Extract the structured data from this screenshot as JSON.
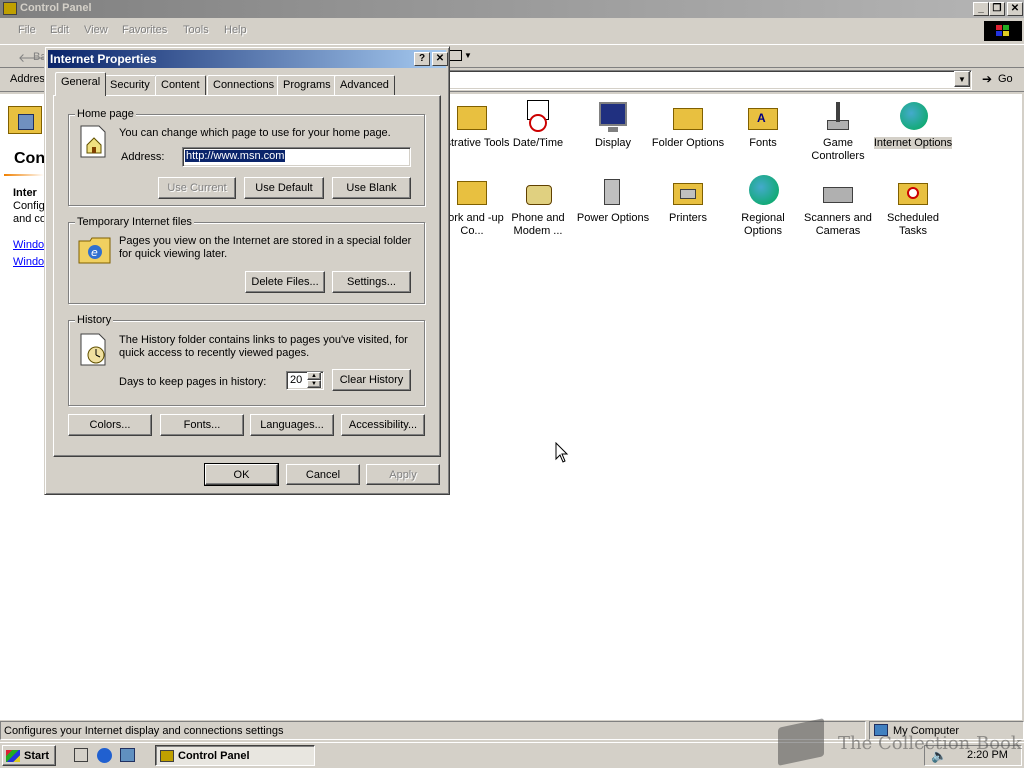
{
  "window": {
    "title": "Control Panel",
    "menu": [
      "File",
      "Edit",
      "View",
      "Favorites",
      "Tools",
      "Help"
    ],
    "toolbar_back": "Ba",
    "address_label": "Addres",
    "go_label": "Go"
  },
  "left_panel": {
    "heading": "Con",
    "subheading": "Inter",
    "desc_line1": "Config",
    "desc_line2": "and co",
    "link1": "Windo",
    "link2": "Windo"
  },
  "icons": [
    {
      "label": "inistrative Tools",
      "icon": "admin-tools-icon"
    },
    {
      "label": "Date/Time",
      "icon": "calendar-clock-icon"
    },
    {
      "label": "Display",
      "icon": "monitor-icon"
    },
    {
      "label": "Folder Options",
      "icon": "folder-options-icon"
    },
    {
      "label": "Fonts",
      "icon": "fonts-folder-icon"
    },
    {
      "label": "Game Controllers",
      "icon": "joystick-icon"
    },
    {
      "label": "Internet Options",
      "icon": "globe-icon"
    },
    {
      "label": "work and -up Co...",
      "icon": "network-icon"
    },
    {
      "label": "Phone and Modem ...",
      "icon": "phone-icon"
    },
    {
      "label": "Power Options",
      "icon": "power-plug-icon"
    },
    {
      "label": "Printers",
      "icon": "printer-folder-icon"
    },
    {
      "label": "Regional Options",
      "icon": "globe-icon"
    },
    {
      "label": "Scanners and Cameras",
      "icon": "scanner-icon"
    },
    {
      "label": "Scheduled Tasks",
      "icon": "scheduled-tasks-icon"
    }
  ],
  "status": {
    "text": "Configures your Internet display and connections settings",
    "zone": "My Computer"
  },
  "taskbar": {
    "start": "Start",
    "task": "Control Panel",
    "clock": "2:20 PM",
    "watermark": "The Collection Book"
  },
  "dialog": {
    "title": "Internet Properties",
    "tabs": [
      "General",
      "Security",
      "Content",
      "Connections",
      "Programs",
      "Advanced"
    ],
    "homepage": {
      "legend": "Home page",
      "desc": "You can change which page to use for your home page.",
      "address_label": "Address:",
      "address_value": "http://www.msn.com",
      "use_current": "Use Current",
      "use_default": "Use Default",
      "use_blank": "Use Blank"
    },
    "temp": {
      "legend": "Temporary Internet files",
      "desc": "Pages you view on the Internet are stored in a special folder for quick viewing later.",
      "delete_files": "Delete Files...",
      "settings": "Settings..."
    },
    "history": {
      "legend": "History",
      "desc": "The History folder contains links to pages you've visited, for quick access to recently viewed pages.",
      "days_label": "Days to keep pages in history:",
      "days_value": "20",
      "clear": "Clear History"
    },
    "bottom_buttons": {
      "colors": "Colors...",
      "fonts": "Fonts...",
      "languages": "Languages...",
      "accessibility": "Accessibility..."
    },
    "ok": "OK",
    "cancel": "Cancel",
    "apply": "Apply"
  }
}
